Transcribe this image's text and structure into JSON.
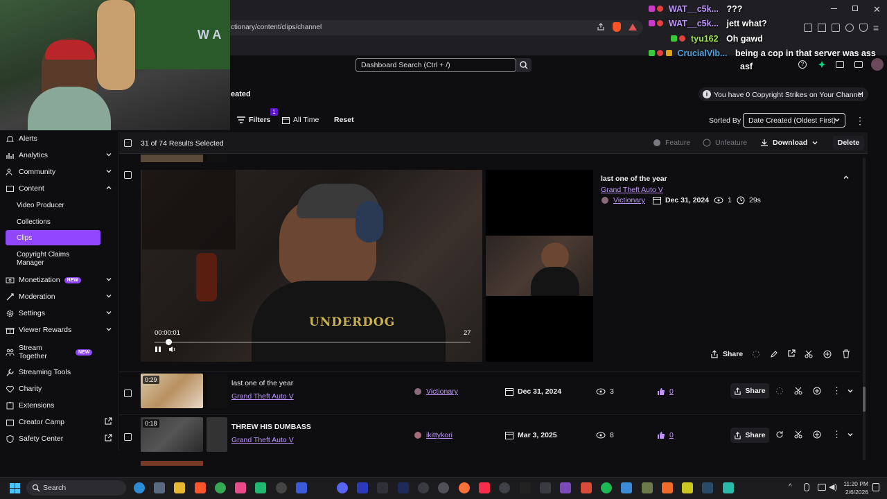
{
  "browser": {
    "address": "ctionary/content/clips/channel"
  },
  "dashboard": {
    "search_placeholder": "Dashboard Search (Ctrl + /)",
    "page_title_fragment": "eated",
    "copyright_notice": "You have 0 Copyright Strikes on Your Channel"
  },
  "sidebar": {
    "items": [
      {
        "label": "Alerts",
        "icon": "bell-icon"
      },
      {
        "label": "Analytics",
        "icon": "chart-icon"
      },
      {
        "label": "Community",
        "icon": "people-icon"
      },
      {
        "label": "Content",
        "icon": "content-icon"
      },
      {
        "label": "Monetization",
        "icon": "money-icon",
        "badge": "NEW"
      },
      {
        "label": "Moderation",
        "icon": "sword-icon"
      },
      {
        "label": "Settings",
        "icon": "gear-icon"
      },
      {
        "label": "Viewer Rewards",
        "icon": "gift-icon"
      },
      {
        "label": "Stream Together",
        "icon": "group-icon",
        "badge": "NEW"
      },
      {
        "label": "Streaming Tools",
        "icon": "tools-icon"
      },
      {
        "label": "Charity",
        "icon": "heart-icon"
      },
      {
        "label": "Extensions",
        "icon": "puzzle-icon"
      },
      {
        "label": "Creator Camp",
        "icon": "camp-icon"
      },
      {
        "label": "Safety Center",
        "icon": "shield-icon"
      }
    ],
    "content_sub": [
      "Video Producer",
      "Collections",
      "Clips",
      "Copyright Claims Manager"
    ]
  },
  "filters": {
    "filters_label": "Filters",
    "filters_count": "1",
    "time_label": "All Time",
    "reset_label": "Reset",
    "sorted_by_label": "Sorted By",
    "sort_value": "Date Created (Oldest First)"
  },
  "results": {
    "summary": "31 of 74 Results Selected",
    "feature": "Feature",
    "unfeature": "Unfeature",
    "download": "Download",
    "delete": "Delete"
  },
  "expanded_clip": {
    "title": "last one of the year",
    "game": "Grand Theft Auto V",
    "creator": "Victionary",
    "date": "Dec 31, 2024",
    "views": "1",
    "duration": "29s",
    "time_current": "00:00:01",
    "time_marker": "27",
    "share": "Share",
    "shirt_text": "UNDERDOG"
  },
  "clips": [
    {
      "duration": "0:29",
      "title": "last one of the year",
      "game": "Grand Theft Auto V",
      "creator": "Victionary",
      "date": "Dec 31, 2024",
      "views": "3",
      "likes": "0",
      "share": "Share"
    },
    {
      "duration": "0:18",
      "title": "THREW HIS DUMBASS",
      "game": "Grand Theft Auto V",
      "creator": "ikittykori",
      "date": "Mar 3, 2025",
      "views": "8",
      "likes": "0",
      "share": "Share"
    }
  ],
  "stream_chat": [
    {
      "user": "WAT__c5k...",
      "message": "???"
    },
    {
      "user": "WAT__c5k...",
      "message": "jett what?"
    },
    {
      "user": "tyu162",
      "message": "Oh gawd"
    },
    {
      "user": "CrucialVib...",
      "message": "being a cop in that server was ass"
    },
    {
      "user": "",
      "message": "asf"
    }
  ],
  "webcam": {
    "sign_text": "W A"
  },
  "taskbar": {
    "search_label": "Search",
    "time": "11:20 PM",
    "date": "2/6/2026"
  },
  "colors": {
    "accent": "#9147ff",
    "link": "#bf94ff",
    "background": "#0e0e10"
  }
}
